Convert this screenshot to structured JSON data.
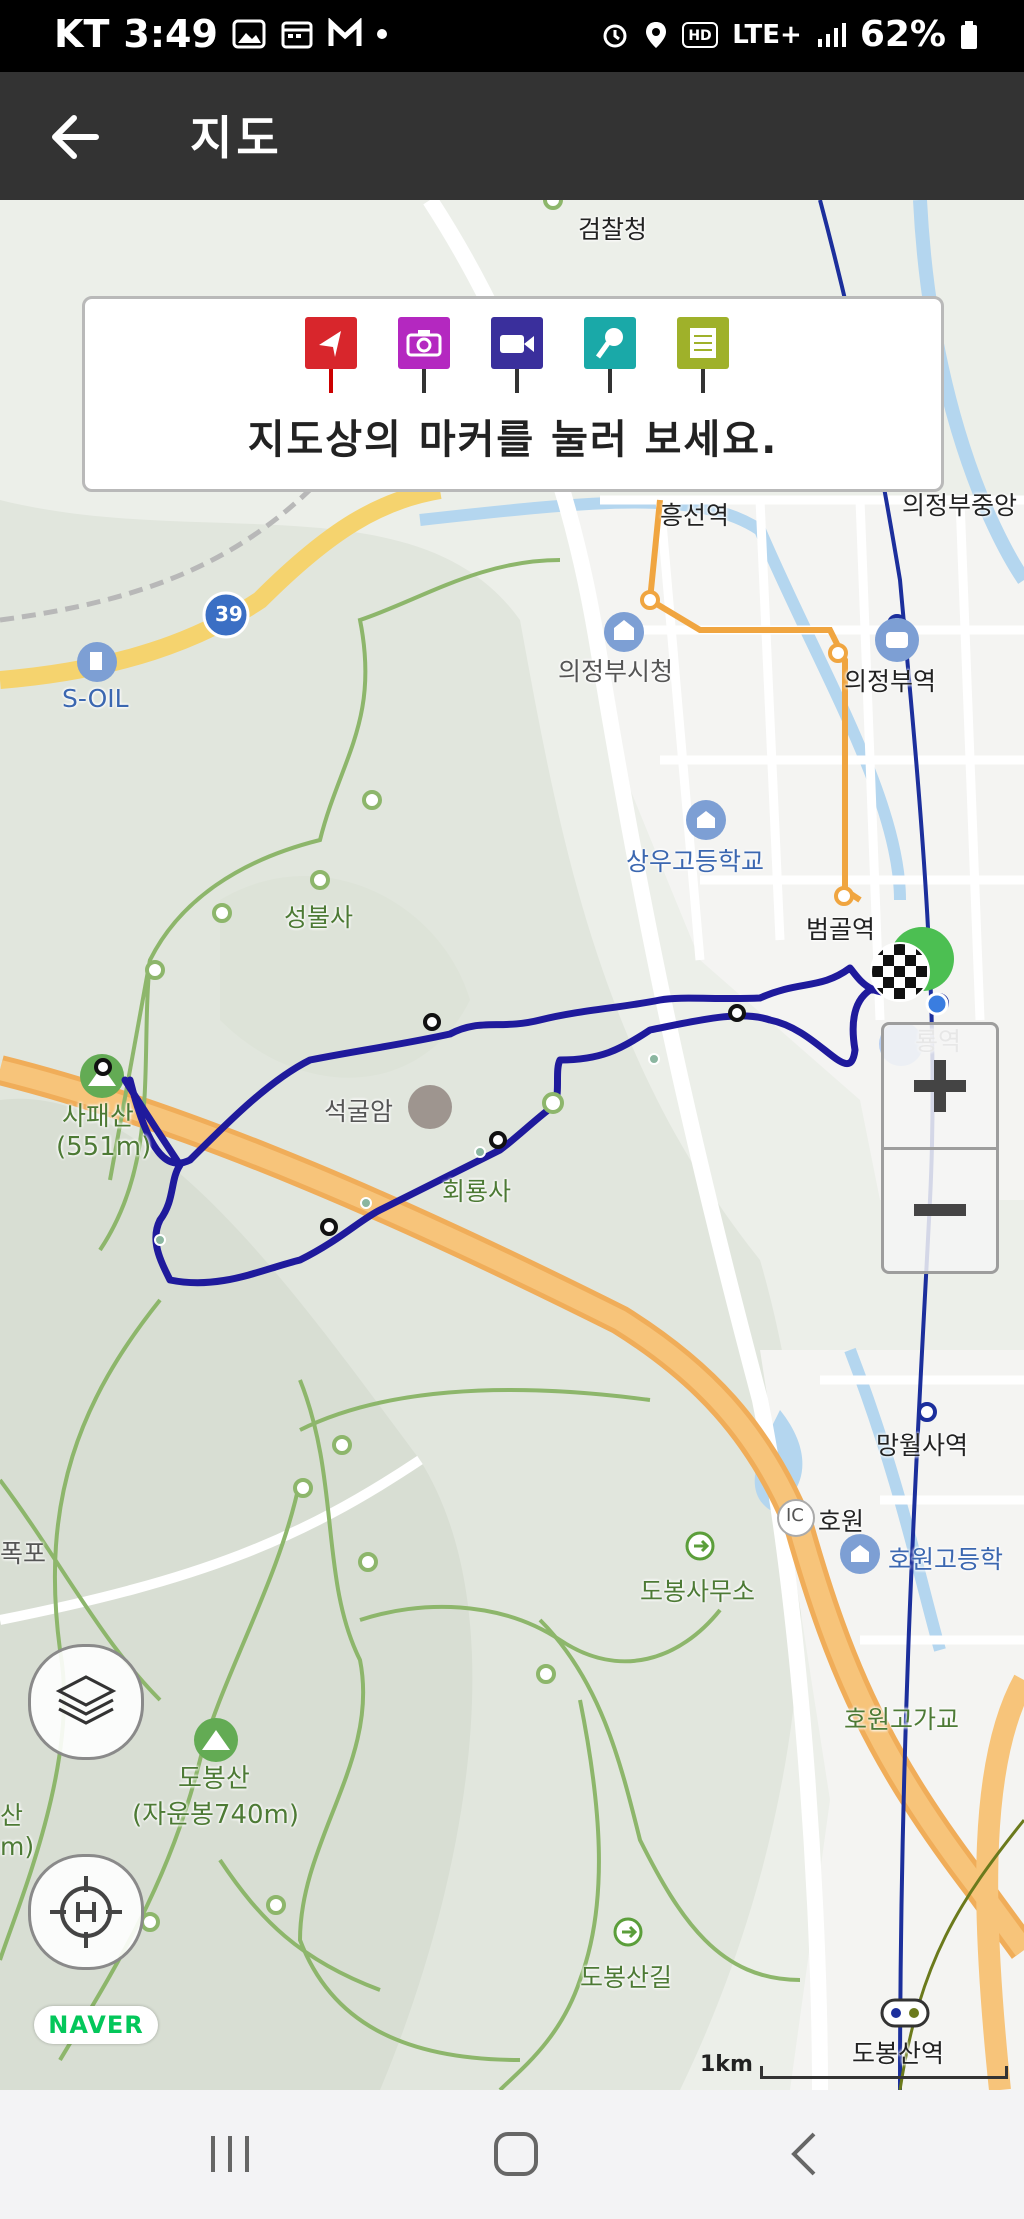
{
  "status_bar": {
    "carrier": "KT",
    "time": "3:49",
    "network": "LTE+",
    "battery": "62%"
  },
  "app_bar": {
    "title": "지도"
  },
  "legend": {
    "markers": [
      {
        "name": "start",
        "color": "#d8262c"
      },
      {
        "name": "photo",
        "color": "#b428c0"
      },
      {
        "name": "video",
        "color": "#3a2f9c"
      },
      {
        "name": "voice",
        "color": "#1aa9a8"
      },
      {
        "name": "memo",
        "color": "#9fb12a"
      }
    ],
    "instruction": "지도상의 마커를 눌러 보세요."
  },
  "map": {
    "route_color": "#1f1a9c",
    "labels": {
      "prosecutor": "검찰청",
      "heungseon_station": "흥선역",
      "uijeongbu_jungang": "의정부중앙",
      "uijeongbu_cityhall": "의정부시청",
      "uijeongbu_station": "의정부역",
      "route39": "39",
      "s_oil": "S-OIL",
      "sangwoo_highschool": "상우고등학교",
      "seongbulsa": "성불사",
      "beomgol_station": "범골역",
      "hoeryong_station": "룡역",
      "sapaesan": "사패산",
      "sapaesan_height": "(551m)",
      "seokgulam": "석굴암",
      "hoeryongsa": "회룡사",
      "mangwolsa_station": "망월사역",
      "ic_label": "IC",
      "howon": "호원",
      "dobong_office": "도봉사무소",
      "howon_highschool": "호원고등학",
      "pokpo": "폭포",
      "howon_overpass": "호원고가교",
      "dobongsan": "도봉산",
      "dobongsan_peak": "(자운봉740m)",
      "left_m": "m)",
      "left_san": "산",
      "dobongsan_gil": "도봉산길",
      "dobongsan_station": "도봉산역"
    },
    "scale_label": "1km",
    "naver_logo": "NAVER"
  },
  "controls": {
    "zoom_in": "+",
    "zoom_out": "−"
  }
}
